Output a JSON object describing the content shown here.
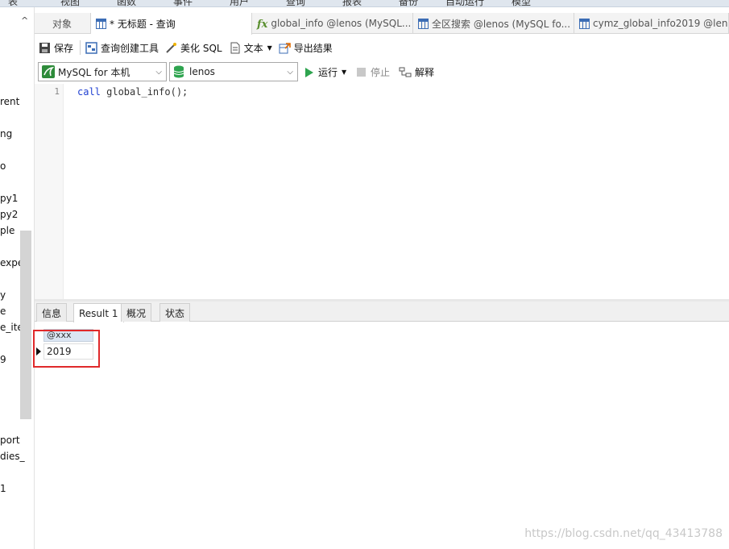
{
  "menu": [
    "表",
    "视图",
    "函数",
    "事件",
    "用户",
    "查询",
    "报表",
    "备份",
    "自动运行",
    "模型"
  ],
  "left_pane": {
    "collapse_icon": "chevron-up-icon",
    "items": [
      "rent",
      "ng",
      "o",
      "py1",
      "py2",
      "ple",
      "expe",
      "y",
      "e",
      "e_ite",
      "9",
      "port",
      "dies_",
      "1"
    ]
  },
  "tabs": [
    {
      "label": "对象",
      "icon": ""
    },
    {
      "label": "* 无标题 - 查询",
      "icon": "query-grid-icon"
    },
    {
      "label": "global_info @lenos (MySQL...",
      "icon": "function-icon"
    },
    {
      "label": "全区搜索 @lenos (MySQL fo...",
      "icon": "table-icon"
    },
    {
      "label": "cymz_global_info2019 @len...",
      "icon": "table-icon"
    }
  ],
  "toolbar": {
    "save": "保存",
    "query_builder": "查询创建工具",
    "beautify": "美化 SQL",
    "text": "文本",
    "export": "导出结果"
  },
  "run_bar": {
    "connection": "MySQL for 本机",
    "database": "lenos",
    "run": "运行",
    "stop": "停止",
    "explain": "解释"
  },
  "editor": {
    "line_number": "1",
    "keyword": "call",
    "statement": " global_info();"
  },
  "result_tabs": [
    "信息",
    "Result 1",
    "概况",
    "状态"
  ],
  "result": {
    "column": "@xxx",
    "value": "2019"
  },
  "watermark": "https://blog.csdn.net/qq_43413788",
  "colors": {
    "highlight_box": "#e0292b",
    "keyword": "#1f3fd1",
    "run_green": "#2ea44f"
  }
}
